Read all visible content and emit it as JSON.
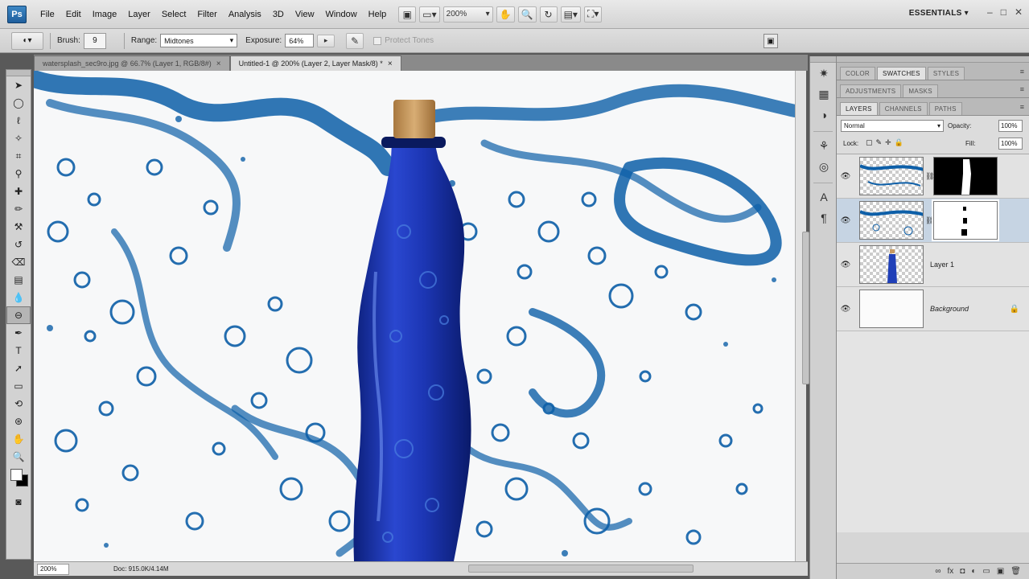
{
  "app": {
    "logo_text": "Ps",
    "menus": [
      "File",
      "Edit",
      "Image",
      "Layer",
      "Select",
      "Filter",
      "Analysis",
      "3D",
      "View",
      "Window",
      "Help"
    ],
    "zoom": "200%",
    "workspace": "ESSENTIALS",
    "window_controls": {
      "minimize": "–",
      "restore": "□",
      "close": "✕"
    }
  },
  "options": {
    "brush_label": "Brush:",
    "brush_size": "9",
    "range_label": "Range:",
    "range_value": "Midtones",
    "exposure_label": "Exposure:",
    "exposure_value": "64%",
    "protect_tones_label": "Protect Tones"
  },
  "documents": [
    {
      "title": "watersplash_sec9ro.jpg @ 66.7% (Layer 1, RGB/8#)",
      "close": "×",
      "active": false
    },
    {
      "title": "Untitled-1 @ 200% (Layer 2, Layer Mask/8) *",
      "close": "×",
      "active": true
    }
  ],
  "status": {
    "zoom": "200%",
    "doc": "Doc: 915.0K/4.14M"
  },
  "panels": {
    "group1_tabs": [
      "COLOR",
      "SWATCHES",
      "STYLES"
    ],
    "group1_active": "SWATCHES",
    "group2_tabs": [
      "ADJUSTMENTS",
      "MASKS"
    ],
    "group3_tabs": [
      "LAYERS",
      "CHANNELS",
      "PATHS"
    ],
    "group3_active": "LAYERS",
    "menu_icon": "≡",
    "blend_mode": "Normal",
    "opacity_label": "Opacity:",
    "opacity_value": "100%",
    "lock_label": "Lock:",
    "fill_label": "Fill:",
    "fill_value": "100%"
  },
  "layers": [
    {
      "name": "",
      "has_mask": true,
      "selected": false,
      "visible": true
    },
    {
      "name": "",
      "has_mask": true,
      "selected": true,
      "visible": true
    },
    {
      "name": "Layer 1",
      "has_mask": false,
      "selected": false,
      "visible": true
    },
    {
      "name": "Background",
      "has_mask": false,
      "selected": false,
      "visible": true,
      "locked": true
    }
  ],
  "colors": {
    "water_blue": "#0d5fa8",
    "bottle_blue": "#1f3fb8",
    "cork": "#c79a62",
    "selection_blue": "#c6d4e3"
  },
  "icons": {
    "eye": "👁",
    "lock": "🔒",
    "chain": "⛓"
  }
}
